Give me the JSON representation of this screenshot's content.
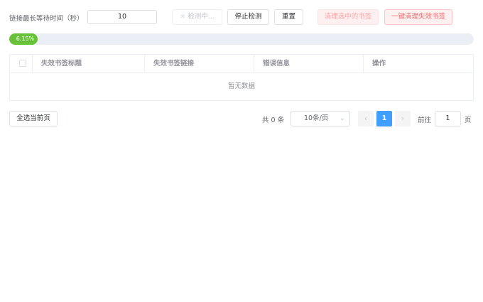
{
  "toolbar": {
    "timeout_label": "链接最长等待时间（秒）",
    "timeout_value": "10",
    "detecting_label": "检测中...",
    "stop_label": "停止检测",
    "reset_label": "重置",
    "clean_selected_label": "清理选中的书签",
    "clean_invalid_label": "一键清理失效书签"
  },
  "progress": {
    "percent": 6.15,
    "text": "6.15%",
    "color": "#67c23a"
  },
  "table": {
    "columns": [
      "失效书签标题",
      "失效书签链接",
      "错误信息",
      "操作"
    ],
    "rows": [],
    "empty_text": "暂无数据"
  },
  "footer": {
    "select_all_label": "全选当前页",
    "total_text": "共 0 条",
    "page_size": "10条/页",
    "current_page": "1",
    "goto_label": "前往",
    "goto_value": "1",
    "page_suffix": "页"
  },
  "colors": {
    "primary": "#409eff",
    "success": "#67c23a",
    "danger": "#f56c6c"
  }
}
